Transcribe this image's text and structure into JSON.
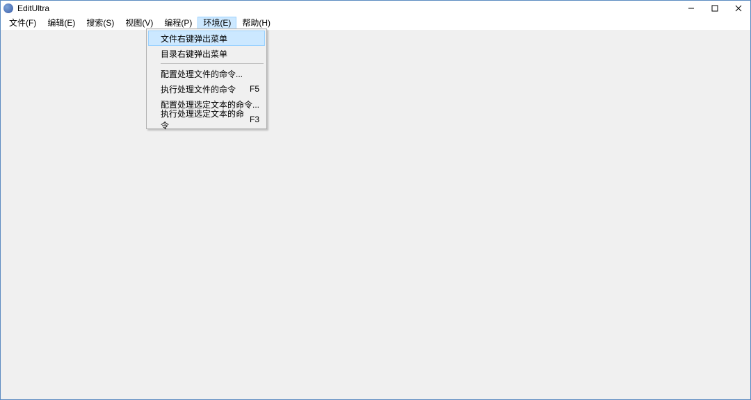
{
  "window": {
    "title": "EditUltra"
  },
  "menubar": {
    "items": [
      {
        "label": "文件(F)"
      },
      {
        "label": "编辑(E)"
      },
      {
        "label": "搜索(S)"
      },
      {
        "label": "视图(V)"
      },
      {
        "label": "编程(P)"
      },
      {
        "label": "环境(E)"
      },
      {
        "label": "帮助(H)"
      }
    ]
  },
  "dropdown": {
    "items": [
      {
        "label": "文件右键弹出菜单",
        "shortcut": ""
      },
      {
        "label": "目录右键弹出菜单",
        "shortcut": ""
      },
      {
        "label": "配置处理文件的命令...",
        "shortcut": ""
      },
      {
        "label": "执行处理文件的命令",
        "shortcut": "F5"
      },
      {
        "label": "配置处理选定文本的命令...",
        "shortcut": ""
      },
      {
        "label": "执行处理选定文本的命令",
        "shortcut": "F3"
      }
    ]
  }
}
